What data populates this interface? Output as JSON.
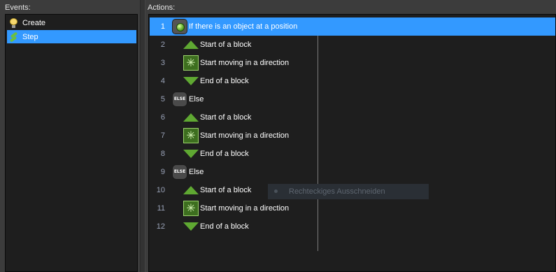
{
  "events": {
    "label": "Events:",
    "items": [
      {
        "label": "Create",
        "icon": "lightbulb-icon",
        "selected": false
      },
      {
        "label": "Step",
        "icon": "steps-icon",
        "selected": true
      }
    ]
  },
  "actions": {
    "label": "Actions:",
    "rows": [
      {
        "num": "1",
        "type": "if",
        "text": "If there is an object at a position",
        "selected": true
      },
      {
        "num": "2",
        "type": "block-start",
        "text": "Start of a block"
      },
      {
        "num": "3",
        "type": "move",
        "text": "Start moving in a direction"
      },
      {
        "num": "4",
        "type": "block-end",
        "text": "End of a block"
      },
      {
        "num": "5",
        "type": "else",
        "text": "Else"
      },
      {
        "num": "6",
        "type": "block-start",
        "text": "Start of a block"
      },
      {
        "num": "7",
        "type": "move",
        "text": "Start moving in a direction"
      },
      {
        "num": "8",
        "type": "block-end",
        "text": "End of a block"
      },
      {
        "num": "9",
        "type": "else",
        "text": "Else"
      },
      {
        "num": "10",
        "type": "block-start",
        "text": "Start of a block"
      },
      {
        "num": "11",
        "type": "move",
        "text": "Start moving in a direction"
      },
      {
        "num": "12",
        "type": "block-end",
        "text": "End of a block"
      }
    ],
    "else_icon_text": "ELSE"
  },
  "tooltip": {
    "text": "Rechteckiges Ausschneiden"
  },
  "colors": {
    "selection": "#3399ff",
    "block_green": "#5fa832"
  }
}
